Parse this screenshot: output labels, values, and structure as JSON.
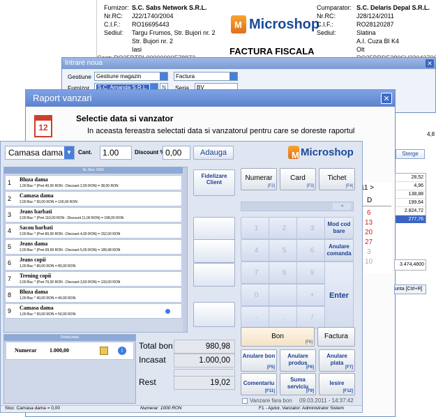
{
  "invoice": {
    "furnizor_label": "Furnizor:",
    "furnizor": "S.C. Sabs Network S.R.L.",
    "nrrc_label": "Nr.RC:",
    "nrrc": "J22/1740/2004",
    "cif_label": "C.I.F.:",
    "cif": "RO16695443",
    "sediul_label": "Sediul:",
    "sediul1": "Targu Frumos, Str. Bujori nr. 2",
    "sediul2": "Str. Bujori nr. 2",
    "sediul3": "Iasi",
    "cont_partial": "Cont: RO25BTRL00000000F78873",
    "logo_text": "Microshop",
    "factura_title": "FACTURA FISCALA",
    "cumparator_label": "Cumparator:",
    "cumparator": "S.C. Delaris Depal S.R.L.",
    "c_nrrc": "J28/124/2011",
    "c_cif": "RO28120287",
    "c_sediul": "Slatina",
    "c_adresa": "A.I. Cuza Bl K4",
    "c_oras": "Olt",
    "c_cont_partial": "RO25BRDE280SV23043700000"
  },
  "intrare": {
    "title": "Intrare noua",
    "gestiune_label": "Gestiune",
    "gestiune": "Gestiune magazin",
    "furnizor_label": "Furnizor",
    "furnizor": "S.C. Amanda S.R.L.",
    "n_btn": "N",
    "doc_type": "Factura",
    "seria_label": "Seria",
    "seria": "BV"
  },
  "raport": {
    "title": "Raport vanzari",
    "heading": "Selectie data si vanzator",
    "subtitle": "In aceasta fereastra selectati data si vanzatorul pentru care se doreste raportul",
    "sterge": "Sterge",
    "right_values": [
      "28,52",
      "4,96",
      "138,88",
      "199,64",
      "2.824,72",
      "277,76"
    ],
    "cal_month": "11 >",
    "cal_day_header": "D",
    "cal_days": [
      "6",
      "13",
      "20",
      "27",
      "3",
      "10"
    ],
    "total": "3.474,4800",
    "cauta": "unta [Ctrl+R]",
    "side_number": "4,8"
  },
  "pos": {
    "product": "Camasa dama",
    "cant_label": "Cant.",
    "cant": "1.00",
    "discount_label": "Discount %",
    "discount": "0,00",
    "adauga": "Adauga",
    "logo_text": "Microshop",
    "bon_header": "Nr. Bon: 0001",
    "items": [
      {
        "n": "1",
        "t": "Bluza dama",
        "d": "1,00 Buc * (Pret 40,00 RON - Discount 2,00 RON) = 38,00 RON"
      },
      {
        "n": "2",
        "t": "Camasa dama",
        "d": "2,00 Buc * 50,00 RON = 100,00 RON"
      },
      {
        "n": "3",
        "t": "Jeans barbati",
        "d": "2,00 Buc * (Pret 110,00 RON - Discount 11,00 RON) = 198,00 RON"
      },
      {
        "n": "4",
        "t": "Sacou barbati",
        "d": "2,00 Buc * (Pret 80,00 RON - Discount 4,00 RON) = 152,00 RON"
      },
      {
        "n": "5",
        "t": "Jeans dama",
        "d": "2,00 Buc * (Pret 99,99 RON - Discount 5,00 RON) = 189,98 RON"
      },
      {
        "n": "6",
        "t": "Jeans copii",
        "d": "1,00 Buc * 80,00 RON = 80,00 RON"
      },
      {
        "n": "7",
        "t": "Trening copii",
        "d": "2,00 Buc * (Pret 70,00 RON - Discount 3,50 RON) = 133,00 RON"
      },
      {
        "n": "8",
        "t": "Bluza dama",
        "d": "1,00 Buc * 40,00 RON = 40,00 RON"
      },
      {
        "n": "9",
        "t": "Camasa dama",
        "d": "1,00 Buc * 50,00 RON = 50,00 RON"
      }
    ],
    "fidelizare": "Fidelizare Client",
    "numerar_btn": "Numerar",
    "numerar_key": "[F2]",
    "card_btn": "Card",
    "card_key": "[F3]",
    "tichet_btn": "Tichet",
    "tichet_key": "[F4]",
    "keys": [
      "1",
      "2",
      "3",
      "4",
      "5",
      "6",
      "7",
      "8",
      "9",
      "0",
      "+",
      "-",
      ".",
      "/"
    ],
    "mod_cod_bare": "Mod cod bare",
    "anulare_comanda": "Anulare comanda",
    "enter": "Enter",
    "detalii_plata": "Detalii plata",
    "plata_tip": "Numerar",
    "plata_suma": "1.000,00",
    "total_bon_label": "Total bon",
    "total_bon": "980,98",
    "incasat_label": "Incasat",
    "incasat": "1.000,00",
    "rest_label": "Rest",
    "rest": "19,02",
    "bon": "Bon",
    "bon_key": "[F8]",
    "factura": "Factura",
    "anulare_bon": "Anulare bon",
    "anulare_bon_key": "[F5]",
    "anulare_produs": "Anulare produs",
    "anulare_produs_key": "[F6]",
    "anulare_plata": "Anulare plata",
    "anulare_plata_key": "[F7]",
    "comentariu": "Comentariu",
    "comentariu_key": "[F11]",
    "suma_serviciu": "Suma serviciu",
    "suma_serviciu_key": "[F9]",
    "iesire": "Iesire",
    "iesire_key": "[F12]",
    "vanzare_fara_bon": "Vanzare fara bon",
    "datetime": "09.03.2011 - 14:37:42",
    "status_stoc": "Stoc: Camasa dama = 0,00",
    "status_numerar": "Numerar: 1000 RON",
    "status_help": "F1 - Ajutor, Vanzator: Administrator Sistem"
  }
}
